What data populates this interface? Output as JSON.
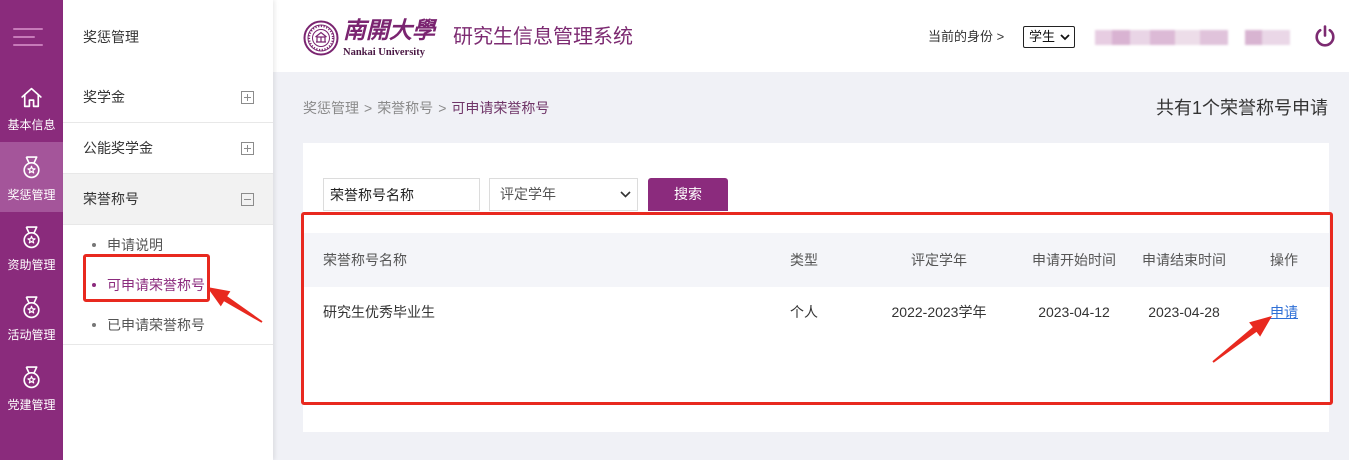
{
  "rail": {
    "items": [
      {
        "label": "基本信息",
        "icon": "home-icon",
        "active": false
      },
      {
        "label": "奖惩管理",
        "icon": "medal-icon",
        "active": true
      },
      {
        "label": "资助管理",
        "icon": "medal-icon",
        "active": false
      },
      {
        "label": "活动管理",
        "icon": "medal-icon",
        "active": false
      },
      {
        "label": "党建管理",
        "icon": "medal-icon",
        "active": false
      }
    ]
  },
  "submenu": {
    "title": "奖惩管理",
    "groups": [
      {
        "label": "奖学金",
        "expanded": false
      },
      {
        "label": "公能奖学金",
        "expanded": false
      },
      {
        "label": "荣誉称号",
        "expanded": true
      }
    ],
    "children": [
      {
        "label": "申请说明",
        "active": false
      },
      {
        "label": "可申请荣誉称号",
        "active": true
      },
      {
        "label": "已申请荣誉称号",
        "active": false
      }
    ]
  },
  "header": {
    "logo_cn": "南開大學",
    "logo_en": "Nankai University",
    "system_title": "研究生信息管理系统",
    "identity_label": "当前的身份 >",
    "identity_value": "学生"
  },
  "breadcrumb": {
    "items": [
      "奖惩管理",
      "荣誉称号",
      "可申请荣誉称号"
    ],
    "separator": ">"
  },
  "summary": "共有1个荣誉称号申请",
  "search": {
    "name_placeholder": "荣誉称号名称",
    "year_select": "评定学年",
    "button": "搜索"
  },
  "table": {
    "columns": [
      "荣誉称号名称",
      "类型",
      "评定学年",
      "申请开始时间",
      "申请结束时间",
      "操作"
    ],
    "rows": [
      [
        "研究生优秀毕业生",
        "个人",
        "2022-2023学年",
        "2023-04-12",
        "2023-04-28",
        "申请"
      ]
    ]
  },
  "colors": {
    "brand": "#8a2b7c",
    "brand_active": "#a4559a",
    "link": "#2f6fd6",
    "annotation": "#e8291f",
    "page_bg": "#f0f1f6"
  }
}
